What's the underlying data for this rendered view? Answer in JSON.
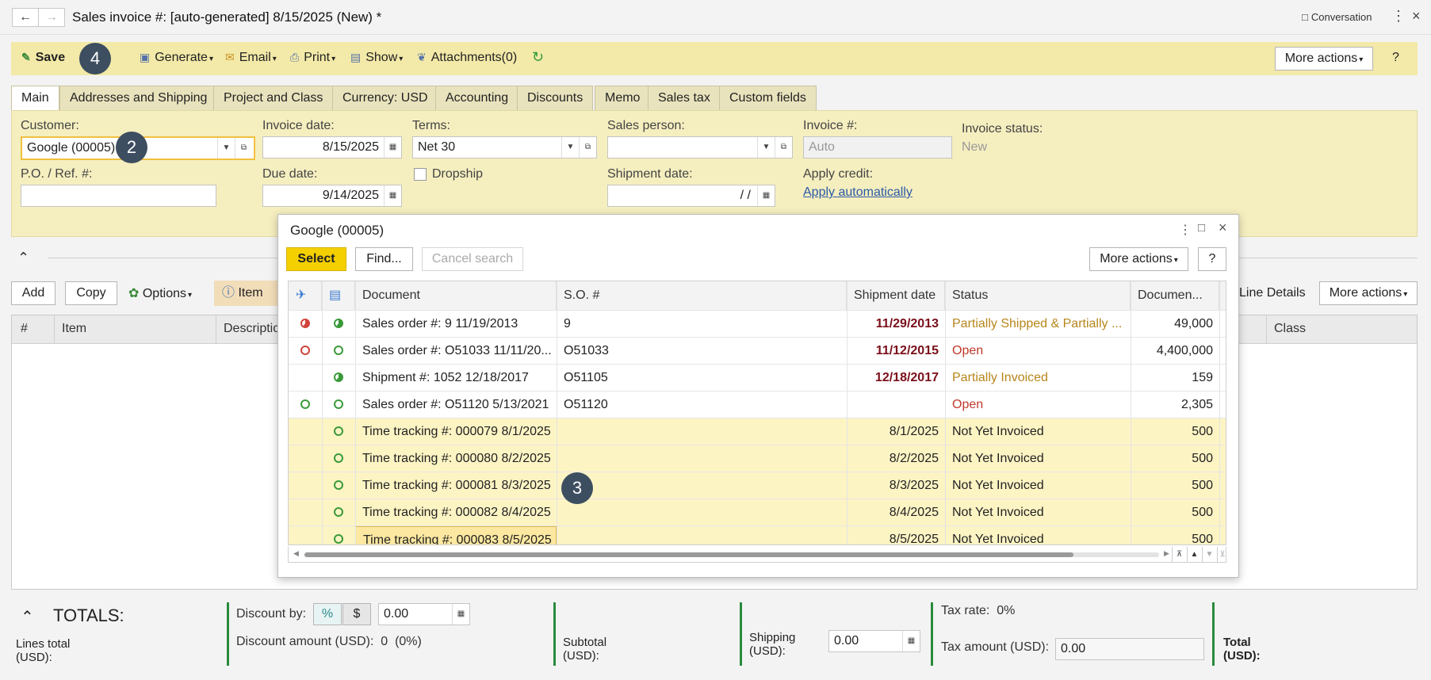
{
  "window": {
    "title": "Sales invoice #: [auto-generated] 8/15/2025 (New) *",
    "conversation": "Conversation"
  },
  "toolbar": {
    "save": "Save",
    "generate": "Generate",
    "email": "Email",
    "print": "Print",
    "show": "Show",
    "attachments": "Attachments(0)",
    "more_actions": "More actions",
    "help": "?"
  },
  "badges": {
    "save": "4",
    "customer": "2",
    "grid": "3"
  },
  "tabs": [
    {
      "label": "Main"
    },
    {
      "label": "Addresses and Shipping"
    },
    {
      "label": "Project and Class"
    },
    {
      "label": "Currency: USD"
    },
    {
      "label": "Accounting"
    },
    {
      "label": "Discounts"
    },
    {
      "label": "Memo"
    },
    {
      "label": "Sales tax"
    },
    {
      "label": "Custom fields"
    }
  ],
  "form": {
    "customer_label": "Customer:",
    "customer_value": "Google (00005)",
    "po_label": "P.O. / Ref. #:",
    "po_value": "",
    "invoice_date_label": "Invoice date:",
    "invoice_date_value": "8/15/2025",
    "due_date_label": "Due date:",
    "due_date_value": "9/14/2025",
    "terms_label": "Terms:",
    "terms_value": "Net 30",
    "dropship_label": "Dropship",
    "sales_person_label": "Sales person:",
    "sales_person_value": "",
    "shipment_date_label": "Shipment date:",
    "shipment_date_value": "/ /",
    "invoice_no_label": "Invoice #:",
    "invoice_no_placeholder": "Auto",
    "apply_credit_label": "Apply credit:",
    "apply_credit_link": "Apply automatically",
    "invoice_status_label": "Invoice status:",
    "invoice_status_value": "New"
  },
  "lines": {
    "add": "Add",
    "copy": "Copy",
    "options": "Options",
    "item": "Item",
    "line_details": "Line Details",
    "more_actions": "More actions",
    "columns": {
      "num": "#",
      "item": "Item",
      "description": "Descriptio",
      "class": "Class"
    }
  },
  "totals": {
    "title": "TOTALS:",
    "lines_total": "Lines total (USD):",
    "discount_by": "Discount by:",
    "pct": "%",
    "usd": "$",
    "discount_value": "0.00",
    "discount_amount": "Discount amount (USD):",
    "discount_amount_value": "0",
    "discount_amount_pct": "(0%)",
    "subtotal": "Subtotal (USD):",
    "shipping": "Shipping (USD):",
    "shipping_value": "0.00",
    "tax_rate_label": "Tax rate:",
    "tax_rate_value": "0%",
    "tax_amount_label": "Tax amount (USD):",
    "tax_amount_value": "0.00",
    "total": "Total (USD):"
  },
  "dialog": {
    "title": "Google (00005)",
    "select": "Select",
    "find": "Find...",
    "cancel_search": "Cancel search",
    "more_actions": "More actions",
    "help": "?",
    "columns": {
      "document": "Document",
      "so": "S.O. #",
      "shipment_date": "Shipment date",
      "status": "Status",
      "document_amount": "Documen..."
    },
    "rows": [
      {
        "s1": "pie-red",
        "s2": "pie-green",
        "document": "Sales order #: 9      11/19/2013",
        "so": "9",
        "ship": "11/29/2013",
        "ship_style": "date-red",
        "status": "Partially Shipped & Partially ...",
        "status_style": "st-gold",
        "amount": "49,000",
        "tt": false
      },
      {
        "s1": "ring-red",
        "s2": "ring-green",
        "document": "Sales order #: O51033 11/11/20...",
        "so": "O51033",
        "ship": "11/12/2015",
        "ship_style": "date-red",
        "status": "Open",
        "status_style": "st-red",
        "amount": "4,400,000",
        "tt": false
      },
      {
        "s1": "",
        "s2": "pie-green",
        "document": "Shipment #: 1052 12/18/2017",
        "so": "O51105",
        "ship": "12/18/2017",
        "ship_style": "date-red",
        "status": "Partially Invoiced",
        "status_style": "st-gold",
        "amount": "159",
        "tt": false
      },
      {
        "s1": "ring-green",
        "s2": "ring-green",
        "document": "Sales order #: O51120 5/13/2021",
        "so": "O51120",
        "ship": "",
        "ship_style": "",
        "status": "Open",
        "status_style": "st-red",
        "amount": "2,305",
        "tt": false
      },
      {
        "s1": "",
        "s2": "ring-green",
        "document": "Time tracking #: 000079 8/1/2025",
        "so": "",
        "ship": "8/1/2025",
        "ship_style": "",
        "status": "Not Yet Invoiced",
        "status_style": "",
        "amount": "500",
        "tt": true
      },
      {
        "s1": "",
        "s2": "ring-green",
        "document": "Time tracking #: 000080 8/2/2025",
        "so": "",
        "ship": "8/2/2025",
        "ship_style": "",
        "status": "Not Yet Invoiced",
        "status_style": "",
        "amount": "500",
        "tt": true
      },
      {
        "s1": "",
        "s2": "ring-green",
        "document": "Time tracking #: 000081 8/3/2025",
        "so": "",
        "ship": "8/3/2025",
        "ship_style": "",
        "status": "Not Yet Invoiced",
        "status_style": "",
        "amount": "500",
        "tt": true
      },
      {
        "s1": "",
        "s2": "ring-green",
        "document": "Time tracking #: 000082 8/4/2025",
        "so": "",
        "ship": "8/4/2025",
        "ship_style": "",
        "status": "Not Yet Invoiced",
        "status_style": "",
        "amount": "500",
        "tt": true
      },
      {
        "s1": "",
        "s2": "ring-green",
        "document": "Time tracking #: 000083 8/5/2025",
        "so": "",
        "ship": "8/5/2025",
        "ship_style": "",
        "status": "Not Yet Invoiced",
        "status_style": "",
        "amount": "500",
        "tt": true,
        "selected": true
      }
    ]
  },
  "icons": {
    "back": "arrow-left-icon",
    "forward": "arrow-right-icon",
    "refresh_color": "#2e9a3a",
    "select_button_color": "#f5d000",
    "toolbar_color": "#f3e9a8"
  }
}
